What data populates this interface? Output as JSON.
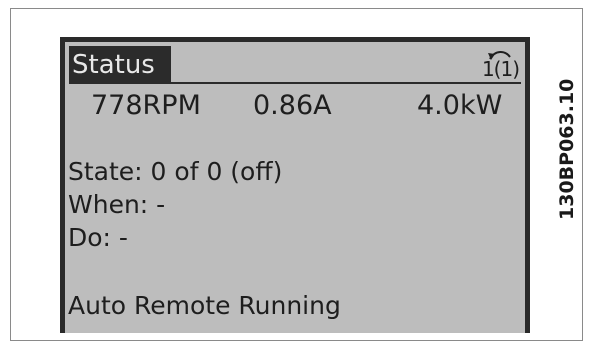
{
  "display": {
    "title": "Status",
    "menu_indicator": "1(1)",
    "readings": [
      "778RPM",
      "0.86A",
      "4.0kW"
    ],
    "lines": [
      "State: 0 of 0 (off)",
      "When: -",
      "Do: -"
    ],
    "status": "Auto Remote Running"
  },
  "figure_code": "130BP063.10",
  "icons": {
    "menu": "menu-arrow-icon"
  },
  "colors": {
    "lcd_background": "#bdbdbd",
    "lcd_text": "#1e1e1e",
    "title_highlight": "#2b2b2b",
    "bezel": "#2a2a2a"
  }
}
